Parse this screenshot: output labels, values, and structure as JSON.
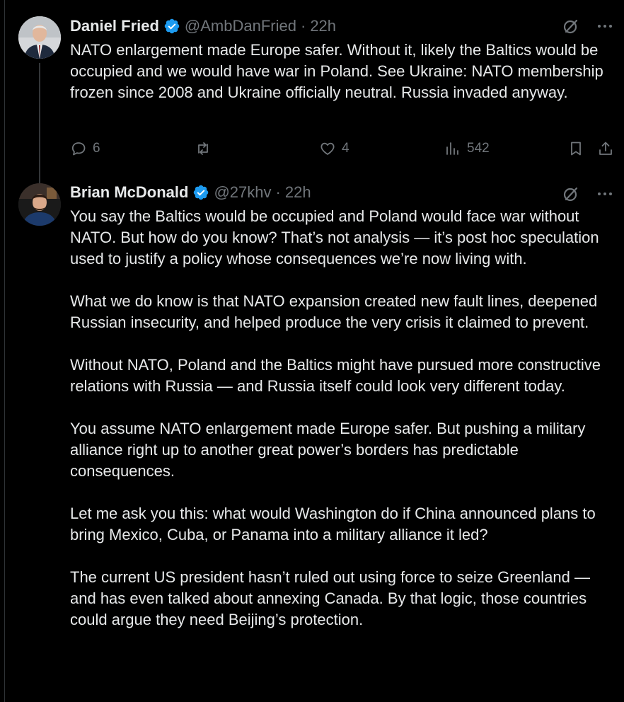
{
  "tweets": [
    {
      "name": "Daniel Fried",
      "handle": "@AmbDanFried",
      "dot": "·",
      "time": "22h",
      "text": "NATO enlargement made Europe safer. Without it, likely the Baltics would be occupied and we would have war in Poland. See Ukraine: NATO membership frozen since 2008 and Ukraine officially neutral. Russia invaded anyway.",
      "replies": "6",
      "reposts": "",
      "likes": "4",
      "views": "542"
    },
    {
      "name": "Brian McDonald",
      "handle": "@27khv",
      "dot": "·",
      "time": "22h",
      "text": "You say the Baltics would be occupied and Poland would face war without NATO. But how do you know? That’s not analysis — it’s post hoc speculation used to justify a policy whose consequences we’re now living with.\n\nWhat we do know is that NATO expansion created new fault lines, deepened Russian insecurity, and helped produce the very crisis it claimed to prevent.\n\nWithout NATO, Poland and the Baltics might have pursued more constructive relations with Russia — and Russia itself could look very different today.\n\nYou assume NATO enlargement made Europe safer. But pushing a military alliance right up to another great power’s borders has predictable consequences.\n\nLet me ask you this: what would Washington do if China announced plans to bring Mexico, Cuba, or Panama into a military alliance it led?\n\nThe current US president hasn’t ruled out using force to seize Greenland — and has even talked about annexing Canada. By that logic, those countries could argue they need Beijing’s protection."
    }
  ],
  "colors": {
    "background": "#000000",
    "text": "#e7e9ea",
    "muted": "#71767b",
    "verified": "#1d9bf0",
    "divider": "#2f3336"
  },
  "icons": [
    "verified-badge-icon",
    "grok-icon",
    "more-icon",
    "reply-icon",
    "repost-icon",
    "like-icon",
    "views-icon",
    "bookmark-icon",
    "share-icon"
  ]
}
